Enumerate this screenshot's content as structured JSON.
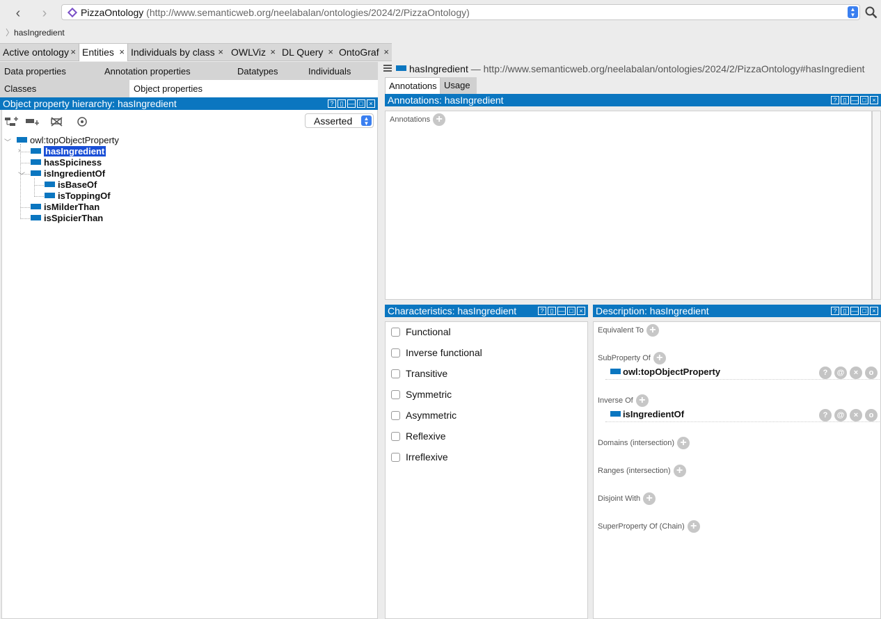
{
  "nav": {
    "back": "‹",
    "forward": "›"
  },
  "address": {
    "name": "PizzaOntology",
    "iri": "(http://www.semanticweb.org/neelabalan/ontologies/2024/2/PizzaOntology)"
  },
  "breadcrumb": "hasIngredient",
  "tabs": [
    {
      "label": "Active ontology",
      "close": "×"
    },
    {
      "label": "Entities",
      "close": "×"
    },
    {
      "label": "Individuals by class",
      "close": "×"
    },
    {
      "label": "OWLViz",
      "close": "×"
    },
    {
      "label": "DL Query",
      "close": "×"
    },
    {
      "label": "OntoGraf",
      "close": "×"
    }
  ],
  "subtabs": {
    "row1": [
      "Data properties",
      "Annotation properties",
      "Datatypes",
      "Individuals"
    ],
    "row2": [
      "Classes",
      "Object properties"
    ]
  },
  "hierarchy": {
    "title": "Object property hierarchy: hasIngredient",
    "mode": "Asserted",
    "root": "owl:topObjectProperty",
    "items": [
      "hasIngredient",
      "hasSpiciness",
      "isIngredientOf",
      "isBaseOf",
      "isToppingOf",
      "isMilderThan",
      "isSpicierThan"
    ]
  },
  "entity": {
    "name": "hasIngredient",
    "iri": "— http://www.semanticweb.org/neelabalan/ontologies/2024/2/PizzaOntology#hasIngredient"
  },
  "right_tabs": [
    "Annotations",
    "Usage"
  ],
  "annotations": {
    "title": "Annotations: hasIngredient",
    "label": "Annotations"
  },
  "characteristics": {
    "title": "Characteristics: hasIngredient",
    "items": [
      "Functional",
      "Inverse functional",
      "Transitive",
      "Symmetric",
      "Asymmetric",
      "Reflexive",
      "Irreflexive"
    ]
  },
  "description": {
    "title": "Description: hasIngredient",
    "sections": [
      "Equivalent To",
      "SubProperty Of",
      "Inverse Of",
      "Domains (intersection)",
      "Ranges (intersection)",
      "Disjoint With",
      "SuperProperty Of (Chain)"
    ],
    "subproperty_of": "owl:topObjectProperty",
    "inverse_of": "isIngredientOf"
  },
  "header_buttons": [
    "?",
    "▯",
    "—",
    "□",
    "×"
  ],
  "row_buttons": [
    "?",
    "@",
    "×",
    "o"
  ]
}
